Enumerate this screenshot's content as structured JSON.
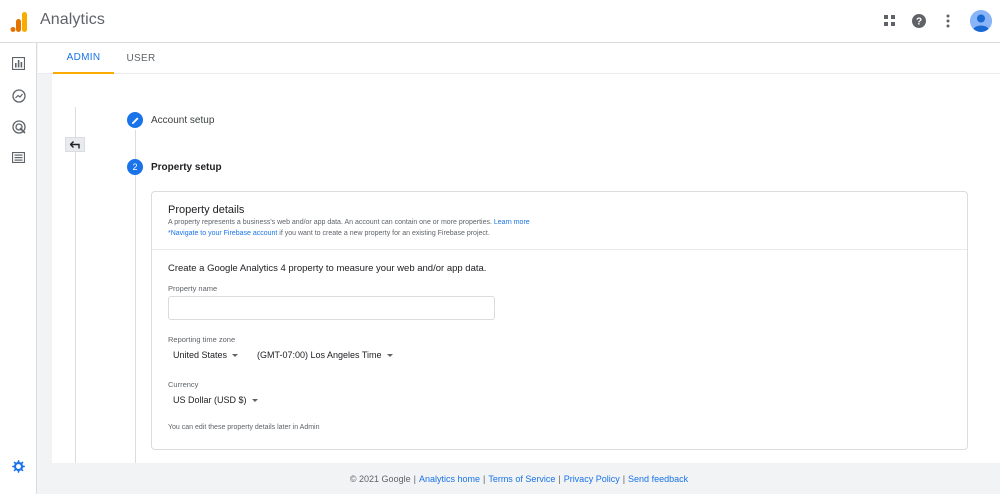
{
  "header": {
    "app_title": "Analytics",
    "icons": [
      "analytics-logo",
      "apps-grid-icon",
      "help-icon",
      "more-vert-icon",
      "account-avatar"
    ]
  },
  "left_nav": {
    "icons": [
      "bar-chart-icon",
      "explore-icon",
      "advertising-icon",
      "list-icon"
    ],
    "bottom_icon": "gear-icon"
  },
  "tabs": [
    {
      "label": "ADMIN",
      "active": true
    },
    {
      "label": "USER",
      "active": false
    }
  ],
  "steps": [
    {
      "number": "",
      "label": "Account setup",
      "done": true
    },
    {
      "number": "2",
      "label": "Property setup",
      "done": false
    }
  ],
  "card": {
    "title": "Property details",
    "desc_text": "A property represents a business's web and/or app data. An account can contain one or more properties.",
    "desc_link": "Learn more",
    "firebase_link": "*Navigate to your Firebase account",
    "firebase_text": "if you want to create a new property for an existing Firebase project.",
    "intro": "Create a Google Analytics 4 property to measure your web and/or app data.",
    "property_name_label": "Property name",
    "property_name_value": "",
    "timezone_label": "Reporting time zone",
    "country_value": "United States",
    "timezone_value": "(GMT-07:00) Los Angeles Time",
    "currency_label": "Currency",
    "currency_value": "US Dollar (USD $)",
    "note": "You can edit these property details later in Admin"
  },
  "footer": {
    "copyright": "© 2021 Google",
    "links": [
      "Analytics home",
      "Terms of Service",
      "Privacy Policy",
      "Send feedback"
    ]
  },
  "colors": {
    "accent": "#1a73e8",
    "tab_indicator": "#f9ab00",
    "logo_orange": "#f9ab00",
    "logo_dark_orange": "#e37400"
  }
}
